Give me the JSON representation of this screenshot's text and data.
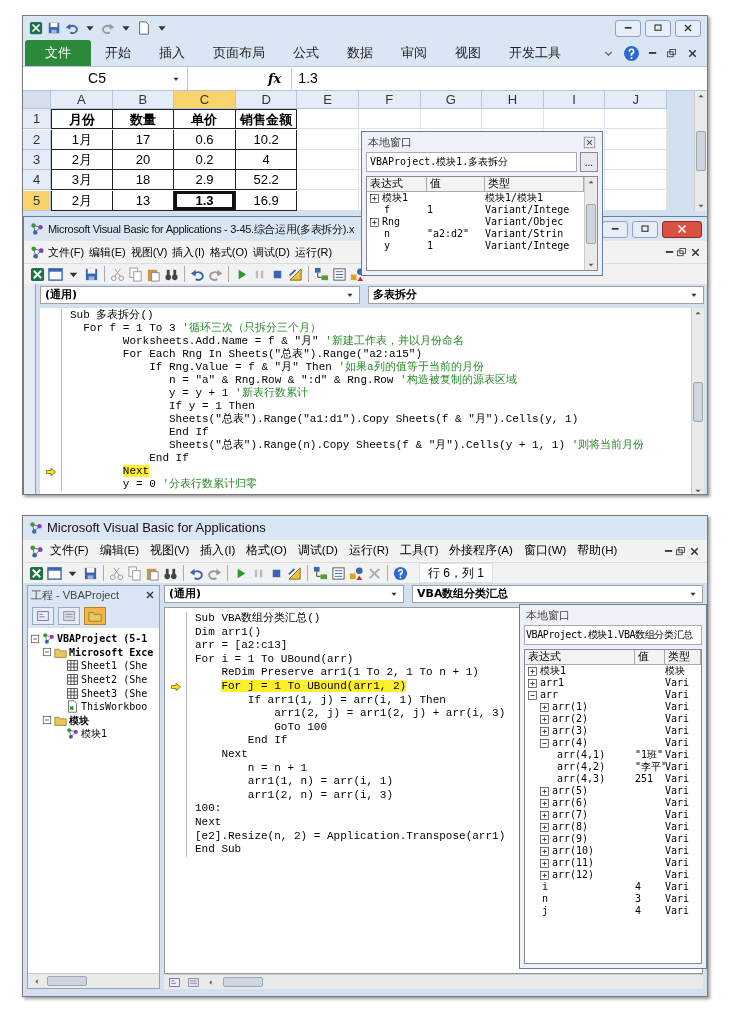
{
  "excel": {
    "ribbon_tabs": [
      {
        "label": "文件",
        "selected": true
      },
      {
        "label": "开始",
        "selected": false
      },
      {
        "label": "插入",
        "selected": false
      },
      {
        "label": "页面布局",
        "selected": false
      },
      {
        "label": "公式",
        "selected": false
      },
      {
        "label": "数据",
        "selected": false
      },
      {
        "label": "审阅",
        "selected": false
      },
      {
        "label": "视图",
        "selected": false
      },
      {
        "label": "开发工具",
        "selected": false
      }
    ],
    "name_box": "C5",
    "formula_label": "fx",
    "formula": "1.3",
    "columns": [
      {
        "label": "A",
        "selected": false
      },
      {
        "label": "B",
        "selected": false
      },
      {
        "label": "C",
        "selected": true
      },
      {
        "label": "D",
        "selected": false
      },
      {
        "label": "E",
        "selected": false
      },
      {
        "label": "F",
        "selected": false
      },
      {
        "label": "G",
        "selected": false
      },
      {
        "label": "H",
        "selected": false
      },
      {
        "label": "I",
        "selected": false
      },
      {
        "label": "J",
        "selected": false
      }
    ],
    "rows": [
      {
        "label": "1",
        "kind": "header",
        "selected": false,
        "cells": [
          {
            "text": "月份",
            "selected": false
          },
          {
            "text": "数量",
            "selected": false
          },
          {
            "text": "单价",
            "selected": false
          },
          {
            "text": "销售金额",
            "selected": false
          }
        ]
      },
      {
        "label": "2",
        "kind": "data",
        "selected": false,
        "cells": [
          {
            "text": "1月",
            "selected": false
          },
          {
            "text": "17",
            "selected": false
          },
          {
            "text": "0.6",
            "selected": false
          },
          {
            "text": "10.2",
            "selected": false
          }
        ]
      },
      {
        "label": "3",
        "kind": "data",
        "selected": false,
        "cells": [
          {
            "text": "2月",
            "selected": false
          },
          {
            "text": "20",
            "selected": false
          },
          {
            "text": "0.2",
            "selected": false
          },
          {
            "text": "4",
            "selected": false
          }
        ]
      },
      {
        "label": "4",
        "kind": "data",
        "selected": false,
        "cells": [
          {
            "text": "3月",
            "selected": false
          },
          {
            "text": "18",
            "selected": false
          },
          {
            "text": "2.9",
            "selected": false
          },
          {
            "text": "52.2",
            "selected": false
          }
        ]
      },
      {
        "label": "5",
        "kind": "data",
        "selected": true,
        "cells": [
          {
            "text": "2月",
            "selected": false
          },
          {
            "text": "13",
            "selected": false
          },
          {
            "text": "1.3",
            "selected": true
          },
          {
            "text": "16.9",
            "selected": false
          }
        ]
      }
    ]
  },
  "vba_1": {
    "title": "Microsoft Visual Basic for Applications - 3-45.综合运用(多表拆分).x",
    "menus": [
      "文件(F)",
      "编辑(E)",
      "视图(V)",
      "插入(I)",
      "格式(O)",
      "调试(D)",
      "运行(R)"
    ],
    "object_box": "(通用)",
    "procedure_box": "多表拆分",
    "code": [
      {
        "code": "Sub 多表拆分()",
        "current": false
      },
      {
        "code": "  For f = 1 To 3 ",
        "comment": "'循环三次（只拆分三个月）",
        "current": false
      },
      {
        "code": "        Worksheets.Add.Name = f & \"月\" ",
        "comment": "'新建工作表，并以月份命名",
        "current": false
      },
      {
        "code": "        For Each Rng In Sheets(\"总表\").Range(\"a2:a15\")",
        "current": false
      },
      {
        "code": "            If Rng.Value = f & \"月\" Then ",
        "comment": "'如果a列的值等于当前的月份",
        "current": false
      },
      {
        "code": "               n = \"a\" & Rng.Row & \":d\" & Rng.Row ",
        "comment": "'构造被复制的源表区域",
        "current": false
      },
      {
        "code": "               y = y + 1 ",
        "comment": "'新表行数累计",
        "current": false
      },
      {
        "code": "               If y = 1 Then",
        "current": false
      },
      {
        "code": "               Sheets(\"总表\").Range(\"a1:d1\").Copy Sheets(f & \"月\").Cells(y, 1)",
        "current": false
      },
      {
        "code": "               End If",
        "current": false
      },
      {
        "code": "               Sheets(\"总表\").Range(n).Copy Sheets(f & \"月\").Cells(y + 1, 1) ",
        "comment": "'则将当前月份",
        "current": false
      },
      {
        "code": "            End If",
        "current": false
      },
      {
        "code": "        Next",
        "current": true
      },
      {
        "code": "        y = 0 ",
        "comment": "'分表行数累计归零",
        "current": false
      }
    ]
  },
  "locals_1": {
    "title": "本地窗口",
    "context": "VBAProject.模块1.多表拆分",
    "context_button": "...",
    "columns": [
      "表达式",
      "值",
      "类型"
    ],
    "rows": [
      {
        "expression": "模块1",
        "type": "模块1/模块1",
        "kind": "node",
        "expanded": false
      },
      {
        "expression": "f",
        "value": "1",
        "type": "Variant/Intege",
        "kind": "leaf"
      },
      {
        "expression": "Rng",
        "type": "Variant/Objec",
        "kind": "node",
        "expanded": false
      },
      {
        "expression": "n",
        "value": "\"a2:d2\"",
        "type": "Variant/Strin",
        "kind": "leaf"
      },
      {
        "expression": "y",
        "value": "1",
        "type": "Variant/Intege",
        "kind": "leaf"
      }
    ]
  },
  "vba_2": {
    "title": "Microsoft Visual Basic for Applications",
    "menus": [
      "文件(F)",
      "编辑(E)",
      "视图(V)",
      "插入(I)",
      "格式(O)",
      "调试(D)",
      "运行(R)",
      "工具(T)",
      "外接程序(A)",
      "窗口(W)",
      "帮助(H)"
    ],
    "position": "行 6，列 1",
    "project_title": "工程 - VBAProject",
    "view_buttons": [
      {
        "kind": "code",
        "selected": false
      },
      {
        "kind": "object",
        "selected": false
      },
      {
        "kind": "folders",
        "selected": true
      }
    ],
    "project_tree": [
      {
        "label": "VBAProject (5-1",
        "kind": "project",
        "expanded": true,
        "children": [
          {
            "label": "Microsoft Exce",
            "kind": "folder",
            "expanded": true,
            "children": [
              {
                "label": "Sheet1 (She",
                "kind": "sheet"
              },
              {
                "label": "Sheet2 (She",
                "kind": "sheet"
              },
              {
                "label": "Sheet3 (She",
                "kind": "sheet"
              },
              {
                "label": "ThisWorkboo",
                "kind": "workbook"
              }
            ]
          },
          {
            "label": "模块",
            "kind": "folder",
            "expanded": true,
            "children": [
              {
                "label": "模块1",
                "kind": "module"
              }
            ]
          }
        ]
      }
    ],
    "object_box": "(通用)",
    "procedure_box": "VBA数组分类汇总",
    "code": [
      {
        "code": "Sub VBA数组分类汇总()",
        "current": false
      },
      {
        "code": "Dim arr1()",
        "current": false
      },
      {
        "code": "arr = [a2:c13]",
        "current": false
      },
      {
        "code": "For i = 1 To UBound(arr)",
        "current": false
      },
      {
        "code": "    ReDim Preserve arr1(1 To 2, 1 To n + 1)",
        "current": false
      },
      {
        "code": "    For j = 1 To UBound(arr1, 2)",
        "current": true
      },
      {
        "code": "        If arr1(1, j) = arr(i, 1) Then",
        "current": false
      },
      {
        "code": "            arr1(2, j) = arr1(2, j) + arr(i, 3)",
        "current": false
      },
      {
        "code": "            GoTo 100",
        "current": false
      },
      {
        "code": "        End If",
        "current": false
      },
      {
        "code": "    Next",
        "current": false
      },
      {
        "code": "        n = n + 1",
        "current": false
      },
      {
        "code": "        arr1(1, n) = arr(i, 1)",
        "current": false
      },
      {
        "code": "        arr1(2, n) = arr(i, 3)",
        "current": false
      },
      {
        "code": "100:",
        "current": false
      },
      {
        "code": "Next",
        "current": false
      },
      {
        "code": "[e2].Resize(n, 2) = Application.Transpose(arr1)",
        "current": false
      },
      {
        "code": "End Sub",
        "current": false
      }
    ]
  },
  "locals_2": {
    "title": "本地窗口",
    "context": "VBAProject.模块1.VBA数组分类汇总",
    "columns": [
      "表达式",
      "值",
      "类型"
    ],
    "rows": [
      {
        "expression": "模块1",
        "type": "模块",
        "kind": "node",
        "expanded": false
      },
      {
        "expression": "arr1",
        "type": "Vari",
        "kind": "node",
        "expanded": false
      },
      {
        "expression": "arr",
        "type": "Vari",
        "kind": "node",
        "expanded": true,
        "children": [
          {
            "expression": "arr(1)",
            "type": "Vari",
            "kind": "node",
            "expanded": false
          },
          {
            "expression": "arr(2)",
            "type": "Vari",
            "kind": "node",
            "expanded": false
          },
          {
            "expression": "arr(3)",
            "type": "Vari",
            "kind": "node",
            "expanded": false
          },
          {
            "expression": "arr(4)",
            "type": "Vari",
            "kind": "node",
            "expanded": true,
            "children": [
              {
                "expression": "arr(4,1)",
                "value": "\"1班\"",
                "type": "Vari",
                "kind": "leaf"
              },
              {
                "expression": "arr(4,2)",
                "value": "\"李平\"",
                "type": "Vari",
                "kind": "leaf"
              },
              {
                "expression": "arr(4,3)",
                "value": "251",
                "type": "Vari",
                "kind": "leaf"
              }
            ]
          },
          {
            "expression": "arr(5)",
            "type": "Vari",
            "kind": "node",
            "expanded": false
          },
          {
            "expression": "arr(6)",
            "type": "Vari",
            "kind": "node",
            "expanded": false
          },
          {
            "expression": "arr(7)",
            "type": "Vari",
            "kind": "node",
            "expanded": false
          },
          {
            "expression": "arr(8)",
            "type": "Vari",
            "kind": "node",
            "expanded": false
          },
          {
            "expression": "arr(9)",
            "type": "Vari",
            "kind": "node",
            "expanded": false
          },
          {
            "expression": "arr(10)",
            "type": "Vari",
            "kind": "node",
            "expanded": false
          },
          {
            "expression": "arr(11)",
            "type": "Vari",
            "kind": "node",
            "expanded": false
          },
          {
            "expression": "arr(12)",
            "type": "Vari",
            "kind": "node",
            "expanded": false
          }
        ]
      },
      {
        "expression": "i",
        "value": "4",
        "type": "Vari",
        "kind": "leaf"
      },
      {
        "expression": "n",
        "value": "3",
        "type": "Vari",
        "kind": "leaf"
      },
      {
        "expression": "j",
        "value": "4",
        "type": "Vari",
        "kind": "leaf"
      }
    ]
  }
}
